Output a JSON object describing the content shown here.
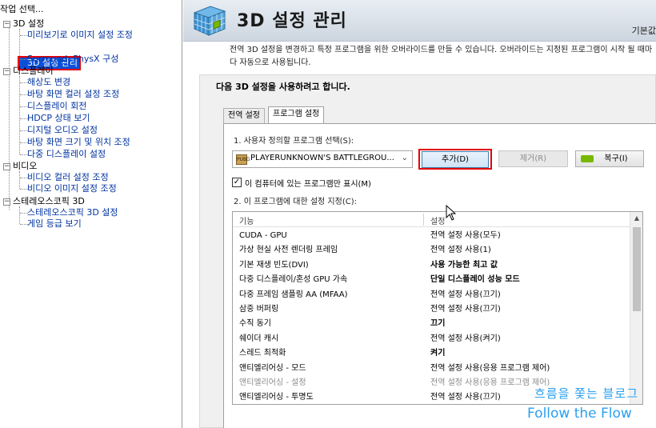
{
  "left_pane": {
    "task_label": "작업 선택...",
    "tree": [
      {
        "label": "3D 설정",
        "type": "category"
      },
      {
        "label": "미리보기로 이미지 설정 조정",
        "type": "item"
      },
      {
        "label": "3D 설정 관리",
        "type": "item",
        "selected": true
      },
      {
        "label": "Surround, PhysX 구성",
        "type": "item"
      },
      {
        "label": "디스플레이",
        "type": "category"
      },
      {
        "label": "해상도 변경",
        "type": "item"
      },
      {
        "label": "바탕 화면 컬러 설정 조정",
        "type": "item"
      },
      {
        "label": "디스플레이 회전",
        "type": "item"
      },
      {
        "label": "HDCP 상태 보기",
        "type": "item"
      },
      {
        "label": "디지털 오디오 설정",
        "type": "item"
      },
      {
        "label": "바탕 화면 크기 및 위치 조정",
        "type": "item"
      },
      {
        "label": "다중 디스플레이 설정",
        "type": "item"
      },
      {
        "label": "비디오",
        "type": "category"
      },
      {
        "label": "비디오 컬러 설정 조정",
        "type": "item"
      },
      {
        "label": "비디오 이미지 설정 조정",
        "type": "item"
      },
      {
        "label": "스테레오스코픽 3D",
        "type": "category"
      },
      {
        "label": "스테레오스코픽 3D 설정",
        "type": "item"
      },
      {
        "label": "게임 등급 보기",
        "type": "item"
      }
    ]
  },
  "header": {
    "title": "3D 설정 관리",
    "right_text": "기본값"
  },
  "description": "전역 3D 설정을 변경하고 특정 프로그램을 위한 오버라이드를 만들 수 있습니다. 오버라이드는 지정된 프로그램이 시작 될 때마다 자동으로 사용됩니다.",
  "panel": {
    "title": "다음 3D 설정을 사용하려고 합니다.",
    "tabs": [
      "전역 설정",
      "프로그램 설정"
    ],
    "active_tab": "프로그램 설정",
    "select_label": "1. 사용자 정의할 프로그램 선택(S):",
    "program_selected": "PLAYERUNKNOWN'S BATTLEGROU...",
    "program_icon_text": "PUBG",
    "add_button": "추가(D)",
    "remove_button": "제거(R)",
    "restore_button": "복구(I)",
    "checkbox_label": "이 컴퓨터에 있는 프로그램만 표시(M)",
    "checkbox_checked": true,
    "settings_label": "2. 이 프로그램에 대한 설정 지정(C):",
    "columns": [
      "기능",
      "설정"
    ],
    "rows": [
      {
        "feature": "CUDA - GPU",
        "setting": "전역 설정 사용(모두)",
        "bold": false,
        "disabled": false
      },
      {
        "feature": "가상 현실 사전 렌더링 프레임",
        "setting": "전역 설정 사용(1)",
        "bold": false,
        "disabled": false
      },
      {
        "feature": "기본 재생 빈도(DVI)",
        "setting": "사용 가능한 최고 값",
        "bold": true,
        "disabled": false
      },
      {
        "feature": "다중 디스플레이/혼성 GPU 가속",
        "setting": "단일 디스플레이 성능 모드",
        "bold": true,
        "disabled": false
      },
      {
        "feature": "다중 프레임 샘플링 AA (MFAA)",
        "setting": "전역 설정 사용(끄기)",
        "bold": false,
        "disabled": false
      },
      {
        "feature": "삼중 버퍼링",
        "setting": "전역 설정 사용(끄기)",
        "bold": false,
        "disabled": false
      },
      {
        "feature": "수직 동기",
        "setting": "끄기",
        "bold": true,
        "disabled": false
      },
      {
        "feature": "쉐이더 캐시",
        "setting": "전역 설정 사용(켜기)",
        "bold": false,
        "disabled": false
      },
      {
        "feature": "스레드 최적화",
        "setting": "켜기",
        "bold": true,
        "disabled": false
      },
      {
        "feature": "앤티엘리어싱 - 모드",
        "setting": "전역 설정 사용(응용 프로그램 제어)",
        "bold": false,
        "disabled": false
      },
      {
        "feature": "앤티엘리어싱 - 설정",
        "setting": "전역 설정 사용(응용 프로그램 제어)",
        "bold": false,
        "disabled": true
      },
      {
        "feature": "앤티엘리어싱 - 투명도",
        "setting": "전역 설정 사용(끄기)",
        "bold": false,
        "disabled": false
      }
    ]
  },
  "watermark": {
    "line1": "흐름을 쫓는 블로그",
    "line2": "Follow the Flow",
    "color": "#2aa0ee"
  },
  "colors": {
    "selection_bg": "#0a50d8",
    "highlight_border": "#e60000",
    "nvidia_green": "#76b900"
  }
}
